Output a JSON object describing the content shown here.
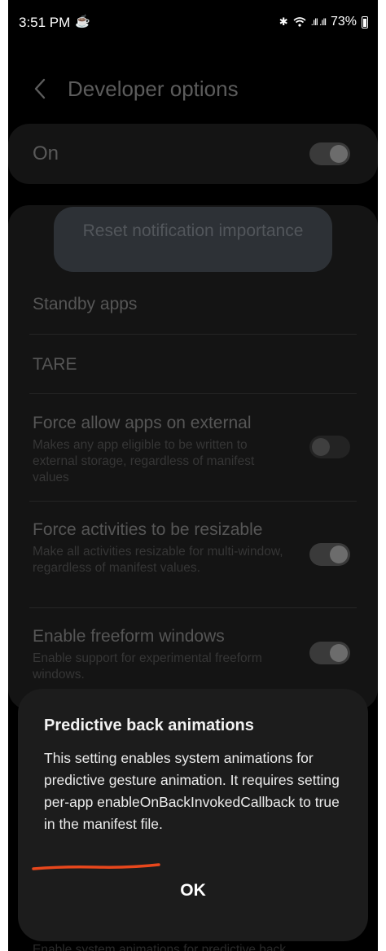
{
  "status_bar": {
    "time": "3:51 PM",
    "battery": "73%",
    "icons": [
      "bluetooth-icon",
      "wifi-icon",
      "signal-icon",
      "battery-icon"
    ]
  },
  "header": {
    "title": "Developer options",
    "back_icon": "chevron-left-icon"
  },
  "master_switch": {
    "label": "On",
    "enabled": true
  },
  "settings": {
    "reset_button_label": "Reset notification importance",
    "items": [
      {
        "title": "Standby apps"
      },
      {
        "title": "TARE"
      },
      {
        "title": "Force allow apps on external",
        "subtitle": "Makes any app eligible to be written to external storage, regardless of manifest values",
        "enabled": false
      },
      {
        "title": "Force activities to be resizable",
        "subtitle": "Make all activities resizable for multi-window, regardless of manifest values.",
        "enabled": true
      },
      {
        "title": "Enable freeform windows",
        "subtitle": "Enable support for experimental freeform windows.",
        "enabled": true
      },
      {
        "subtitle": "Enable system animations for predictive back"
      }
    ]
  },
  "dialog": {
    "title": "Predictive back animations",
    "body": "This setting enables system animations for predictive gesture animation. It requires setting per-app enableOnBackInvokedCallback to true in the manifest file.",
    "ok_label": "OK"
  },
  "colors": {
    "background": "#000000",
    "card": "#141414",
    "dialog": "#1c1c1c",
    "annotation": "#e8471c"
  }
}
